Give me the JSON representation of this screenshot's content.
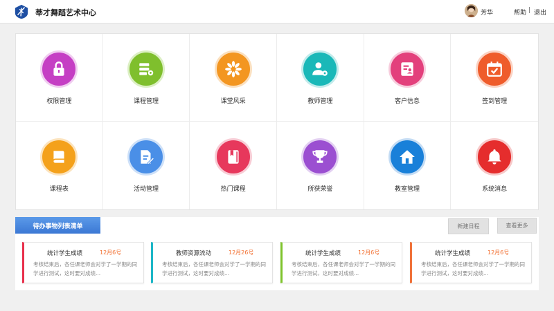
{
  "header": {
    "title": "莘才舞蹈艺术中心",
    "username": "芳华",
    "help": "帮助",
    "separator": "|",
    "logout": "退出"
  },
  "tiles": [
    {
      "label": "权限管理",
      "icon": "lock-icon",
      "color": "#c53fc4"
    },
    {
      "label": "课程管理",
      "icon": "server-gear-icon",
      "color": "#7fbf2d"
    },
    {
      "label": "课堂风采",
      "icon": "flower-icon",
      "color": "#f39621"
    },
    {
      "label": "教师管理",
      "icon": "user-gear-icon",
      "color": "#1ab8b8"
    },
    {
      "label": "客户信息",
      "icon": "contact-card-icon",
      "color": "#e3407c"
    },
    {
      "label": "签到管理",
      "icon": "calendar-check-icon",
      "color": "#ef5c2b"
    },
    {
      "label": "课程表",
      "icon": "book-icon",
      "color": "#f4a11b"
    },
    {
      "label": "活动管理",
      "icon": "document-edit-icon",
      "color": "#4a8fe7"
    },
    {
      "label": "热门课程",
      "icon": "bookmark-book-icon",
      "color": "#e7385c"
    },
    {
      "label": "所获荣誉",
      "icon": "trophy-icon",
      "color": "#9b4fd1"
    },
    {
      "label": "教室管理",
      "icon": "home-icon",
      "color": "#1980d9"
    },
    {
      "label": "系统消息",
      "icon": "bell-icon",
      "color": "#e52d2d"
    }
  ],
  "todo": {
    "title": "待办事物列表清单",
    "new_schedule": "新建日程",
    "view_more": "查看更多",
    "cards": [
      {
        "title": "统计学生成绩",
        "date": "12月6号",
        "body": "考核结束后，各任课老师会对学了一学期的同学进行测试，这时要对成绩...",
        "color": "#e8304c"
      },
      {
        "title": "教师资源流动",
        "date": "12月26号",
        "body": "考核结束后，各任课老师会对学了一学期的同学进行测试，这时要对成绩...",
        "color": "#1cb6c7"
      },
      {
        "title": "统计学生成绩",
        "date": "12月6号",
        "body": "考核结束后，各任课老师会对学了一学期的同学进行测试，这时要对成绩...",
        "color": "#7ec32b"
      },
      {
        "title": "统计学生成绩",
        "date": "12月6号",
        "body": "考核结束后，各任课老师会对学了一学期的同学进行测试，这时要对成绩...",
        "color": "#f0723a"
      }
    ]
  }
}
